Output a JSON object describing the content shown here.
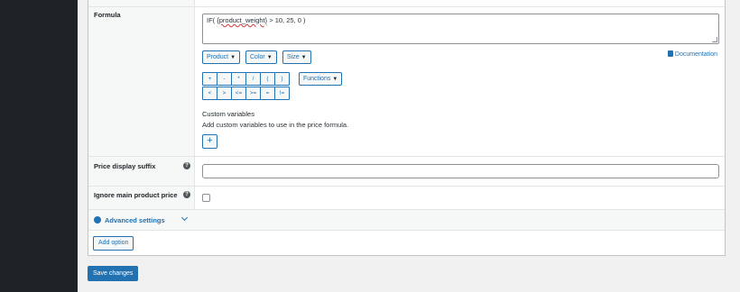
{
  "formula": {
    "label": "Formula",
    "value_prefix": "IF( ",
    "value_token": "{product_weight}",
    "value_suffix": " > 10, 25, 0 )",
    "dropdowns": [
      "Product",
      "Color",
      "Size"
    ],
    "documentation_label": "Documentation",
    "operators": [
      "+",
      "-",
      "*",
      "/",
      "(",
      ")",
      "<",
      ">",
      "<=",
      ">=",
      "=",
      "!="
    ],
    "functions_label": "Functions",
    "custom_variables_title": "Custom variables",
    "custom_variables_desc": "Add custom variables to use in the price formula.",
    "add_variable_label": "+"
  },
  "price_display_suffix": {
    "label": "Price display suffix",
    "value": ""
  },
  "ignore_main_price": {
    "label": "Ignore main product price",
    "checked": false
  },
  "advanced": {
    "label": "Advanced settings"
  },
  "actions": {
    "add_option": "Add option",
    "save_changes": "Save changes"
  },
  "help_icon_glyph": "?",
  "caret_glyph": "▼",
  "colors": {
    "accent": "#2271b1",
    "sidebar": "#1d2327",
    "page_bg": "#f0f0f1"
  }
}
